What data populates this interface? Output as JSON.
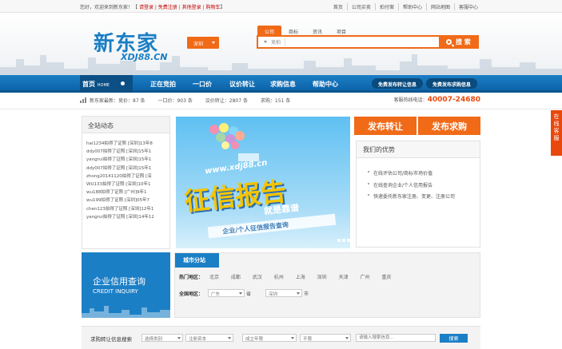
{
  "topbar": {
    "welcome": "您好，欢迎来到新东家！",
    "login_links": [
      "请登录",
      "免费注册",
      "其他登录",
      "购物车"
    ],
    "links": [
      "首页",
      "公司买卖",
      "拍付案",
      "帮助中心",
      "网站地图",
      "客服中心"
    ]
  },
  "logo": {
    "cn": "新东家",
    "en": "XDJ88.CN"
  },
  "city": {
    "label": "深圳"
  },
  "search": {
    "tabs": [
      "公司",
      "商标",
      "资讯",
      "项目"
    ],
    "select_label": "竞拍",
    "placeholder": "",
    "button": "搜 索"
  },
  "nav": {
    "home": "首页",
    "home_en": "HOME",
    "items": [
      "正在竞拍",
      "一口价",
      "议价转让",
      "求购信息",
      "帮助中心"
    ],
    "pills": [
      "免费发布转让信息",
      "免费发布求购信息"
    ]
  },
  "stats": {
    "items": [
      "新东家最新：竞价：87 条",
      "一口价：903 条",
      "议价转让：2807 条",
      "求购：151 条"
    ],
    "hotline_label": "客服热线电话：",
    "hotline": "40007-24680"
  },
  "news": {
    "title": "全站动态",
    "items": [
      "hai1234拍得了证照 [深圳]13年8",
      "ddy007拍得了证照 [深圳]15年1",
      "yangrui拍得了证照 [深圳]15年1",
      "ddy007拍得了证照 [深圳]15年1",
      "zhong20141120拍得了证照 [深",
      "WU133拍得了证照 [深圳]10年1",
      "wu188拍得了证照 [广州]9年1",
      "wu199拍得了证照 [深圳]05年7",
      "chen123拍得了证照 [深圳]12年1",
      "yangrui拍得了证照 [深圳]14年12"
    ]
  },
  "banner": {
    "url": "www.xdj88.cn",
    "big": "征信报告",
    "sub": "就是靠谱",
    "strip": "企业/个人征信报告查询"
  },
  "cta": {
    "left": "发布转让",
    "right": "发布求购"
  },
  "advantages": {
    "title": "我们的优势",
    "items": [
      "在线评估公司/商标市场价值",
      "在线查询企业/个人信用报告",
      "快速委托新东家注册、变更、注册公司"
    ]
  },
  "credit": {
    "cn": "企业信用查询",
    "en": "CREDIT INQUIRY"
  },
  "city_panel": {
    "tab": "城市分站",
    "hot_label": "热门地区：",
    "hot_cities": [
      "北京",
      "成都",
      "武汉",
      "杭州",
      "上海",
      "深圳",
      "天津",
      "广州",
      "重庆"
    ],
    "all_label": "全国地区：",
    "province": "广东",
    "province_suffix": "省",
    "city": "深圳",
    "city_suffix": "市"
  },
  "bottom": {
    "label": "求购转让信息搜索",
    "selects": [
      "选择类别",
      "注册资本",
      "成立年限",
      "不限"
    ],
    "placeholder": "请输入搜索信息...",
    "button": "搜索"
  },
  "float_tab": {
    "label": "在线客服"
  },
  "colors": {
    "brand_blue": "#1b7fc6",
    "accent_orange": "#f06a18",
    "hotline_red": "#e8480c"
  }
}
